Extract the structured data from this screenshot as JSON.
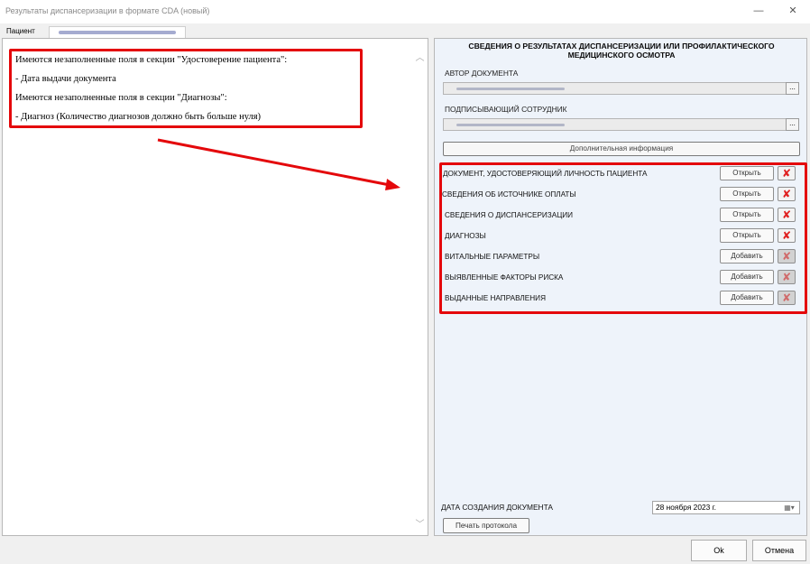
{
  "window": {
    "title": "Результаты диспансеризации в формате CDA (новый)",
    "minimize_glyph": "—",
    "close_glyph": "✕"
  },
  "tabs": {
    "patient_label": "Пациент"
  },
  "messages": [
    "Имеются незаполненные поля в секции \"Удостоверение пациента\":",
    "- Дата выдачи документа",
    "Имеются незаполненные поля в секции \"Диагнозы\":",
    "- Диагноз (Количество диагнозов должно быть больше нуля)"
  ],
  "scrollbar": {
    "up": "︿",
    "down": "﹀"
  },
  "right": {
    "title_line1": "СВЕДЕНИЯ О РЕЗУЛЬТАТАХ ДИСПАНСЕРИЗАЦИИ ИЛИ ПРОФИЛАКТИЧЕСКОГО",
    "title_line2": "МЕДИЦИНСКОГО ОСМОТРА",
    "author_label": "АВТОР ДОКУМЕНТА",
    "signer_label": "ПОДПИСЫВАЮЩИЙ СОТРУДНИК",
    "ellipsis": "...",
    "add_info_button": "Дополнительная информация",
    "sections": [
      {
        "label": "ДОКУМЕНТ, УДОСТОВЕРЯЮЩИЙ ЛИЧНОСТЬ ПАЦИЕНТА",
        "action": "Открыть",
        "delete_enabled": true
      },
      {
        "label": "СВЕДЕНИЯ ОБ ИСТОЧНИКЕ ОПЛАТЫ",
        "action": "Открыть",
        "delete_enabled": true
      },
      {
        "label": "СВЕДЕНИЯ О ДИСПАНСЕРИЗАЦИИ",
        "action": "Открыть",
        "delete_enabled": true
      },
      {
        "label": "ДИАГНОЗЫ",
        "action": "Открыть",
        "delete_enabled": true
      },
      {
        "label": "ВИТАЛЬНЫЕ ПАРАМЕТРЫ",
        "action": "Добавить",
        "delete_enabled": false
      },
      {
        "label": "ВЫЯВЛЕННЫЕ ФАКТОРЫ РИСКА",
        "action": "Добавить",
        "delete_enabled": false
      },
      {
        "label": "ВЫДАННЫЕ НАПРАВЛЕНИЯ",
        "action": "Добавить",
        "delete_enabled": false
      }
    ],
    "delete_glyph": "✘",
    "date_label": "ДАТА СОЗДАНИЯ ДОКУМЕНТА",
    "date_value": "28  ноября  2023 г.",
    "calendar_glyph": "▦▾",
    "print_button": "Печать протокола"
  },
  "footer": {
    "ok": "Ok",
    "cancel": "Отмена"
  },
  "colors": {
    "highlight": "#e4080b",
    "right_panel_bg": "#eef3fa"
  }
}
